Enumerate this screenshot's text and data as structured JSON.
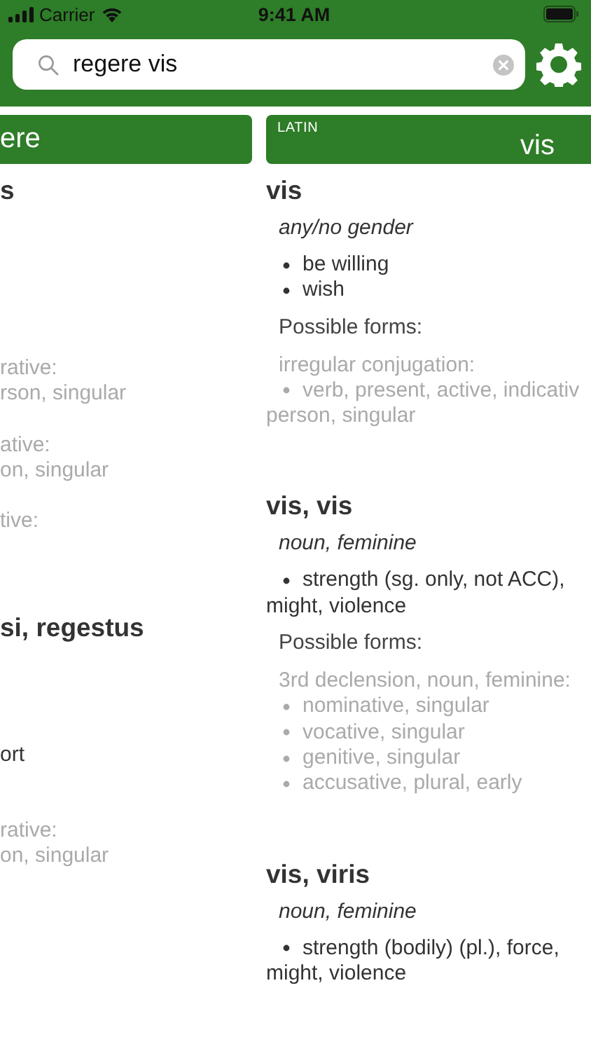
{
  "status_bar": {
    "carrier": "Carrier",
    "time": "9:41 AM"
  },
  "search": {
    "value": "regere vis"
  },
  "left_panel": {
    "header": "ere",
    "lines": [
      {
        "kind": "heading",
        "text": "s"
      },
      {
        "kind": "form",
        "text": "rative:"
      },
      {
        "kind": "form",
        "text": "rson, singular"
      },
      {
        "kind": "form",
        "text": "ative:"
      },
      {
        "kind": "form",
        "text": "on, singular"
      },
      {
        "kind": "form",
        "text": "tive:"
      },
      {
        "kind": "heading",
        "text": "si, regestus"
      },
      {
        "kind": "body",
        "text": "ort"
      },
      {
        "kind": "form",
        "text": "rative:"
      },
      {
        "kind": "form",
        "text": "on, singular"
      }
    ]
  },
  "right_panel": {
    "language": "LATIN",
    "header": "vis",
    "entries": [
      {
        "heading": "vis",
        "grammar": "any/no gender",
        "definitions": [
          [
            "be willing"
          ],
          [
            "wish"
          ]
        ],
        "forms_label": "Possible forms:",
        "forms": {
          "title": "irregular conjugation:",
          "items": [
            [
              "verb, present, active, indicativ",
              "person, singular"
            ]
          ]
        }
      },
      {
        "heading": "vis, vis",
        "grammar": "noun, feminine",
        "definitions": [
          [
            "strength (sg. only, not ACC),",
            "might, violence"
          ]
        ],
        "forms_label": "Possible forms:",
        "forms": {
          "title": "3rd declension, noun, feminine:",
          "items": [
            [
              "nominative, singular"
            ],
            [
              "vocative, singular"
            ],
            [
              "genitive, singular"
            ],
            [
              "accusative, plural, early"
            ]
          ]
        }
      },
      {
        "heading": "vis, viris",
        "grammar": "noun, feminine",
        "definitions": [
          [
            "strength (bodily) (pl.), force,",
            "might, violence"
          ]
        ]
      }
    ]
  }
}
